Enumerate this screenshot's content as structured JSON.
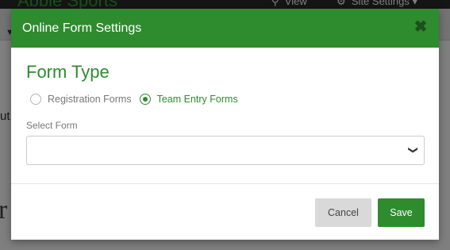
{
  "background": {
    "brand": "Abbie Sports",
    "nav": {
      "view_label": "View",
      "site_settings_label": "Site Settings ▾"
    },
    "partial_text_1": "ut",
    "partial_text_2": "r"
  },
  "modal": {
    "title": "Online Form Settings",
    "close_glyph": "✖",
    "section_heading": "Form Type",
    "form_type_options": [
      {
        "label": "Registration Forms",
        "selected": false
      },
      {
        "label": "Team Entry Forms",
        "selected": true
      }
    ],
    "select_form": {
      "label": "Select Form",
      "value": ""
    },
    "buttons": {
      "cancel": "Cancel",
      "save": "Save"
    }
  },
  "colors": {
    "brand_green": "#2e8b2e",
    "header_green": "#2e8b2e"
  }
}
